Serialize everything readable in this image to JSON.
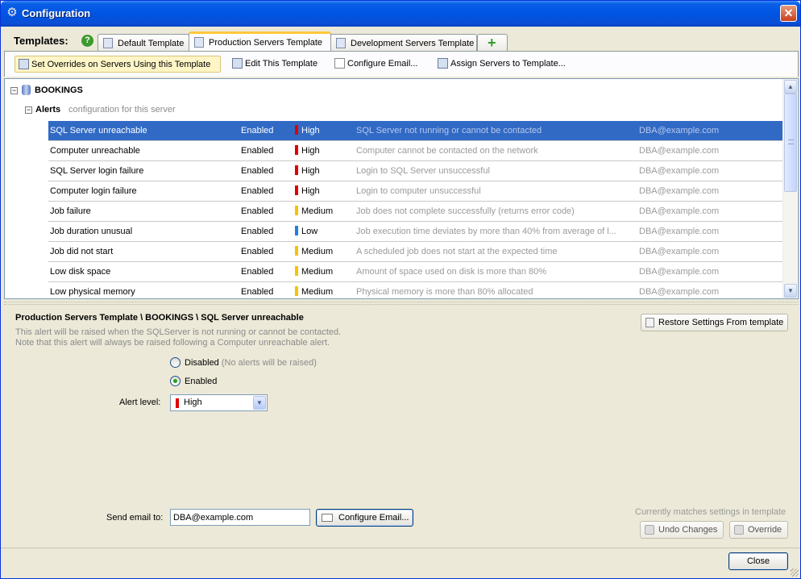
{
  "window": {
    "title": "Configuration",
    "close_glyph": "✕"
  },
  "templates": {
    "label": "Templates:",
    "help_glyph": "?",
    "tabs": [
      {
        "label": "Default Template"
      },
      {
        "label": "Production Servers Template"
      },
      {
        "label": "Development Servers Template"
      }
    ],
    "add_glyph": "+"
  },
  "toolbar": {
    "set_overrides": "Set Overrides on Servers Using this Template",
    "edit_template": "Edit This Template",
    "configure_email": "Configure Email...",
    "assign_servers": "Assign Servers to Template..."
  },
  "tree": {
    "server": "BOOKINGS",
    "expand_glyph": "−",
    "alerts_label": "Alerts",
    "alerts_subtitle": "configuration for this server",
    "level_colors": {
      "High": "#e00000",
      "Medium": "#f5c400",
      "Low": "#1f7fe0"
    },
    "rows": [
      {
        "name": "SQL Server unreachable",
        "status": "Enabled",
        "level": "High",
        "description": "SQL Server not running or cannot be contacted",
        "email": "DBA@example.com"
      },
      {
        "name": "Computer unreachable",
        "status": "Enabled",
        "level": "High",
        "description": "Computer cannot be contacted on the network",
        "email": "DBA@example.com"
      },
      {
        "name": "SQL Server login failure",
        "status": "Enabled",
        "level": "High",
        "description": "Login to SQL Server unsuccessful",
        "email": "DBA@example.com"
      },
      {
        "name": "Computer login failure",
        "status": "Enabled",
        "level": "High",
        "description": "Login to computer unsuccessful",
        "email": "DBA@example.com"
      },
      {
        "name": "Job failure",
        "status": "Enabled",
        "level": "Medium",
        "description": "Job does not complete successfully (returns error code)",
        "email": "DBA@example.com"
      },
      {
        "name": "Job duration unusual",
        "status": "Enabled",
        "level": "Low",
        "description": "Job execution time  deviates by more than 40% from  average of l...",
        "email": "DBA@example.com"
      },
      {
        "name": "Job did not start",
        "status": "Enabled",
        "level": "Medium",
        "description": "A scheduled  job does not start at the expected time",
        "email": "DBA@example.com"
      },
      {
        "name": "Low disk space",
        "status": "Enabled",
        "level": "Medium",
        "description": "Amount of space used on disk is more than 80%",
        "email": "DBA@example.com"
      },
      {
        "name": "Low physical memory",
        "status": "Enabled",
        "level": "Medium",
        "description": "Physical memory is more than 80% allocated",
        "email": "DBA@example.com"
      }
    ],
    "selected_index": 0
  },
  "scrollbar": {
    "up_glyph": "▲",
    "down_glyph": "▼"
  },
  "detail": {
    "breadcrumb": "Production Servers Template \\ BOOKINGS \\ SQL Server unreachable",
    "description_line1": "This alert will be raised when the SQLServer is not running or cannot be contacted.",
    "description_line2": "Note that this alert will always be raised following a Computer unreachable alert.",
    "restore_button": "Restore Settings From template",
    "disabled_label": "Disabled",
    "disabled_hint": "(No alerts will be raised)",
    "enabled_label": "Enabled",
    "alert_level_label": "Alert level:",
    "alert_level_value": "High",
    "dropdown_glyph": "▼",
    "send_email_label": "Send email to:",
    "send_email_value": "DBA@example.com",
    "configure_email_button": "Configure Email...",
    "matches_text": "Currently matches settings in template",
    "undo_button": "Undo Changes",
    "override_button": "Override"
  },
  "footer": {
    "close_button": "Close"
  }
}
